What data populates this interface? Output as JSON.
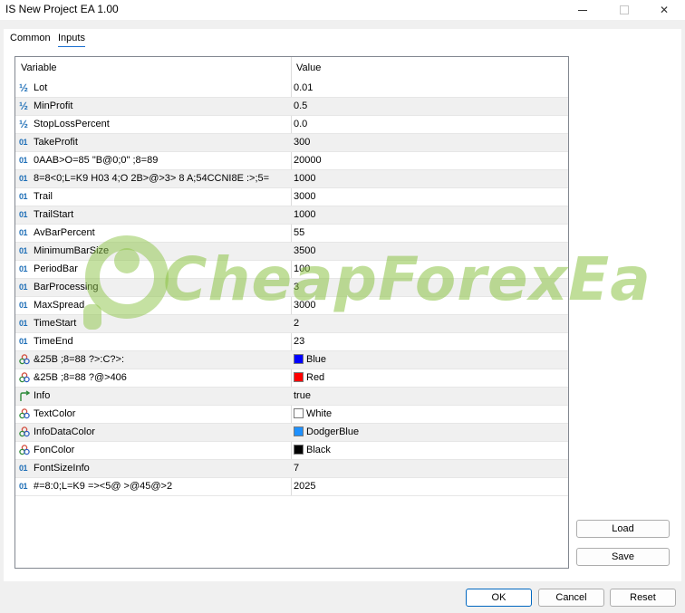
{
  "window": {
    "title": "IS New Project EA 1.00",
    "minimize_glyph": "—",
    "close_glyph": "✕"
  },
  "tabs": [
    {
      "label": "Common",
      "active": false
    },
    {
      "label": "Inputs",
      "active": true
    }
  ],
  "grid": {
    "headers": {
      "variable": "Variable",
      "value": "Value"
    },
    "rows": [
      {
        "type": "double",
        "name": "Lot",
        "value": "0.01"
      },
      {
        "type": "double",
        "name": "MinProfit",
        "value": "0.5"
      },
      {
        "type": "double",
        "name": "StopLossPercent",
        "value": "0.0"
      },
      {
        "type": "int",
        "name": "TakeProfit",
        "value": "300"
      },
      {
        "type": "int",
        "name": "0AAB>O=85 \"B@0;0\" ;8=89",
        "value": "20000"
      },
      {
        "type": "int",
        "name": "8=8<0;L=K9 H03 4;O 2B>@>3> 8 A;54CCNI8E :>;5=",
        "value": "1000"
      },
      {
        "type": "int",
        "name": "Trail",
        "value": "3000"
      },
      {
        "type": "int",
        "name": "TrailStart",
        "value": "1000"
      },
      {
        "type": "int",
        "name": "AvBarPercent",
        "value": "55"
      },
      {
        "type": "int",
        "name": "MinimumBarSize",
        "value": "3500"
      },
      {
        "type": "int",
        "name": "PeriodBar",
        "value": "100"
      },
      {
        "type": "int",
        "name": "BarProcessing",
        "value": "3"
      },
      {
        "type": "int",
        "name": "MaxSpread",
        "value": "3000"
      },
      {
        "type": "int",
        "name": "TimeStart",
        "value": "2"
      },
      {
        "type": "int",
        "name": "TimeEnd",
        "value": "23"
      },
      {
        "type": "color",
        "name": "&25B ;8=88 ?>:C?>:",
        "value": "Blue",
        "swatch": "#0000ff"
      },
      {
        "type": "color",
        "name": "&25B ;8=88 ?@>406",
        "value": "Red",
        "swatch": "#ff0000"
      },
      {
        "type": "bool",
        "name": "Info",
        "value": "true"
      },
      {
        "type": "color",
        "name": "TextColor",
        "value": "White",
        "swatch": "#ffffff"
      },
      {
        "type": "color",
        "name": "InfoDataColor",
        "value": "DodgerBlue",
        "swatch": "#1e90ff"
      },
      {
        "type": "color",
        "name": "FonColor",
        "value": "Black",
        "swatch": "#000000"
      },
      {
        "type": "int",
        "name": "FontSizeInfo",
        "value": "7"
      },
      {
        "type": "int",
        "name": "#=8:0;L=K9 =><5@ >@45@>2",
        "value": "2025"
      }
    ]
  },
  "icons": {
    "double": "½",
    "int": "01",
    "color": "color-palette-icon",
    "bool": "arrow-turn-icon"
  },
  "watermark": {
    "text": "CheapForexEa",
    "color": "#8cc346"
  },
  "buttons": {
    "load": "Load",
    "save": "Save",
    "ok": "OK",
    "cancel": "Cancel",
    "reset": "Reset"
  }
}
